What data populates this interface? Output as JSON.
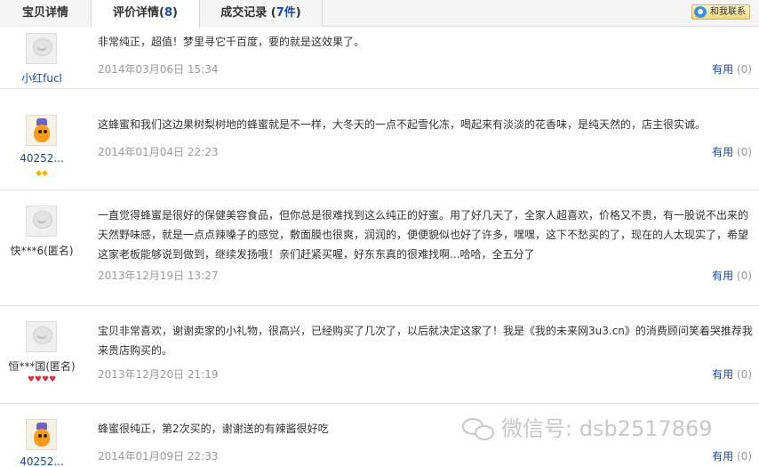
{
  "tabs": [
    {
      "label": "宝贝详情",
      "count": ""
    },
    {
      "label": "评价详情(",
      "count": "8",
      "suffix": ")"
    },
    {
      "label": "成交记录 (",
      "count": "7件",
      "suffix": ")"
    }
  ],
  "contact_label": "和我联系",
  "useful_label": "有用",
  "reviews": [
    {
      "user": "小红fucl",
      "text": "非常纯正，超值！梦里寻它千百度，要的就是这效果了。",
      "date": "2014年03月06日 15:34",
      "useful_count": "(0)"
    },
    {
      "user": "40252...",
      "rank": "◆◆",
      "text": "这蜂蜜和我们这边果树梨树地的蜂蜜就是不一样，大冬天的一点不起雪化冻，喝起来有淡淡的花香味，是纯天然的，店主很实诚。",
      "date": "2014年01月04日 22:23",
      "useful_count": "(0)"
    },
    {
      "user": "快***6(匿名)",
      "text": "一直觉得蜂蜜是很好的保健美容食品，但你总是很难找到这么纯正的好蜜。用了好几天了，全家人超喜欢，价格又不贵，有一股说不出来的天然野味感，就是一点点辣嗓子的感觉，敷面膜也很爽，润润的，便便貌似也好了许多，嘿嘿，这下不愁买的了，现在的人太现实了，希望这家老板能够说到做到，继续发扬哦！亲们赶紧买喔，好东东真的很难找啊...哈哈，全五分了",
      "date": "2013年12月19日 13:27",
      "useful_count": "(0)"
    },
    {
      "user": "恒***国(匿名)",
      "rank": "♥♥♥♥",
      "text": "宝贝非常喜欢，谢谢卖家的小礼物，很高兴，已经购买了几次了，以后就决定这家了！我是《我的未来网3u3.cn》的消费顾问笑着哭推荐我来贵店购买的。",
      "date": "2013年12月20日 21:19",
      "useful_count": "(0)"
    },
    {
      "user": "40252...",
      "text": "蜂蜜很纯正，第2次买的，谢谢送的有辣酱很好吃",
      "date": "2014年01月09日 22:33",
      "useful_count": "(0)"
    }
  ],
  "watermark": "微信号: dsb2517869"
}
